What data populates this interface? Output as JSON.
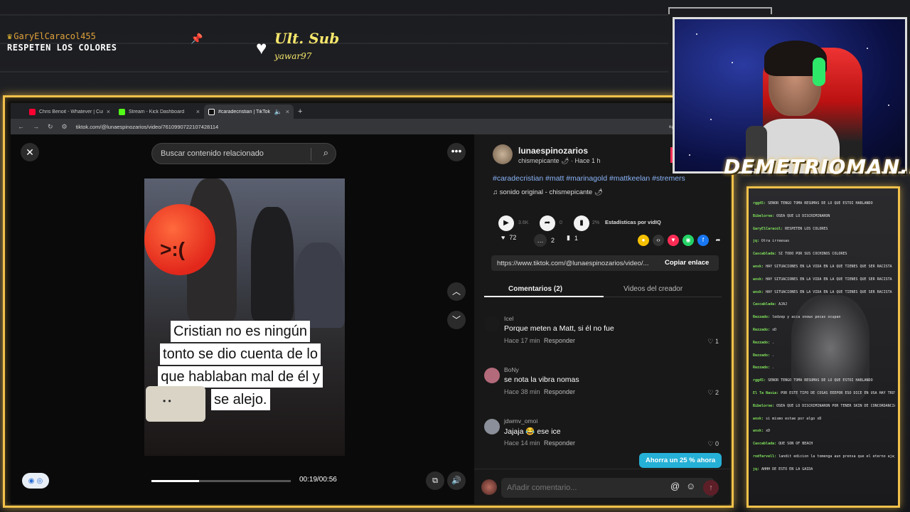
{
  "overlay": {
    "top_user": "GaryElCaracol455",
    "top_message": "RESPETEN LOS COLORES",
    "last_sub_label": "Ult. Sub",
    "last_sub_name": "yawar97",
    "streamer_name": "DEMETRIOMAN...",
    "accent_color": "#f2c14a"
  },
  "browser": {
    "tabs": [
      {
        "title": "Chris Benoit - Whatever | Custo",
        "favicon_color": "#ff0033",
        "active": false
      },
      {
        "title": "Stream - Kick Dashboard",
        "favicon_color": "#53fc18",
        "active": false
      },
      {
        "title": "#caradecristian | TikTok",
        "favicon_color": "#ffffff",
        "active": true
      }
    ],
    "url": "tiktok.com/@lunaespinozarios/video/7610990722107428114"
  },
  "video": {
    "search_placeholder": "Buscar contenido relacionado",
    "caption_lines": [
      "Cristian no es ningún",
      "tonto se dio cuenta de lo",
      "que hablaban mal de él y",
      "se alejo."
    ],
    "time": "00:19/00:56",
    "progress": 0.34
  },
  "post": {
    "author": "lunaespinozarios",
    "meta": "chismepicante 🌶 · Hace 1 h",
    "hashtags": "#caradecristian #matt #marinagold #mattkeelan #stremers",
    "sound": "sonido original - chismepicante 🌶",
    "views": "3.6K",
    "shares_small": "0",
    "stats_pct": "2%",
    "stats_label": "Estadísticas por vidIQ",
    "likes": "72",
    "comments_count": "2",
    "saves": "1",
    "link": "https://www.tiktok.com/@lunaespinozarios/video/...",
    "copy_label": "Copiar enlace",
    "tab_comments": "Comentarios (2)",
    "tab_videos": "Videos del creador"
  },
  "comments": [
    {
      "name": "Icel",
      "text": "Porque meten a Matt, si él no fue",
      "time": "Hace 17 min",
      "reply": "Responder",
      "likes": "1",
      "avatar_color": "#1a1a1a"
    },
    {
      "name": "BoNy",
      "text": "se nota la vibra nomas",
      "time": "Hace 38 min",
      "reply": "Responder",
      "likes": "2",
      "avatar_color": "#b36a7a"
    },
    {
      "name": "jdwmv_omoi",
      "text": "Jajaja 😂 ese ice",
      "time": "Hace 14 min",
      "reply": "Responder",
      "likes": "0",
      "avatar_color": "#8a8f99"
    }
  ],
  "comment_bar": {
    "placeholder": "Añadir comentario...",
    "promo": "Ahorra un 25 % ahora"
  },
  "chat": [
    {
      "user": "rgg45:",
      "msg": "SEÑOR TENGO TOMA RESUMAS DE LO QUE ESTOI HABLANDO"
    },
    {
      "user": "Bibelorne:",
      "msg": "OSEA QUE LO DISCRIMINARON"
    },
    {
      "user": "GaryElCaracol:",
      "msg": "RESPETEN LOS COLORES"
    },
    {
      "user": "jq:",
      "msg": "Otra irreesas"
    },
    {
      "user": "Cascablada:",
      "msg": "SI TODO POR SUS COCHINOS COLORES"
    },
    {
      "user": "wnsk:",
      "msg": "HAY SITUACIONES EN LA VIDA EN LA QUE TIENES QUE SER RACISTA"
    },
    {
      "user": "wnsk:",
      "msg": "HAY SITUACIONES EN LA VIDA EN LA QUE TIENES QUE SER RACISTA"
    },
    {
      "user": "wnsk:",
      "msg": "HAY SITUACIONES EN LA VIDA EN LA QUE TIENES QUE SER RACISTA"
    },
    {
      "user": "Cascablada:",
      "msg": "AJAJ"
    },
    {
      "user": "Rezzado:",
      "msg": "ledzep y acca snowx pecas ocupan"
    },
    {
      "user": "Rezzado:",
      "msg": "xD"
    },
    {
      "user": "Rezzado:",
      "msg": "."
    },
    {
      "user": "Rezzado:",
      "msg": "."
    },
    {
      "user": "Rezzado:",
      "msg": "."
    },
    {
      "user": "rgg45:",
      "msg": "SEÑOR TENGO TOMA RESUMAS DE LO QUE ESTOI HABLANDO"
    },
    {
      "user": "El Ta Nasia:",
      "msg": "POR ESTE TIPO DE COSAS EEEPOR ESO DICE EN USA HAY TROTEOS"
    },
    {
      "user": "Bibelorne:",
      "msg": "OSEA QUE LO DISCRIMINARON POR TENER SKIN DE CONCORDANCIA ?"
    },
    {
      "user": "wnsk:",
      "msg": "si mismo estae por algo xD"
    },
    {
      "user": "wnsk:",
      "msg": "xD"
    },
    {
      "user": "Cascablada:",
      "msg": "QUE SON OF BEACH"
    },
    {
      "user": "rodfarvell:",
      "msg": "landit edicion la tomenga aun prensa que el eterno ajaja"
    },
    {
      "user": "jq:",
      "msg": "AHHH DE ESTO EN LA GAIDA"
    }
  ]
}
